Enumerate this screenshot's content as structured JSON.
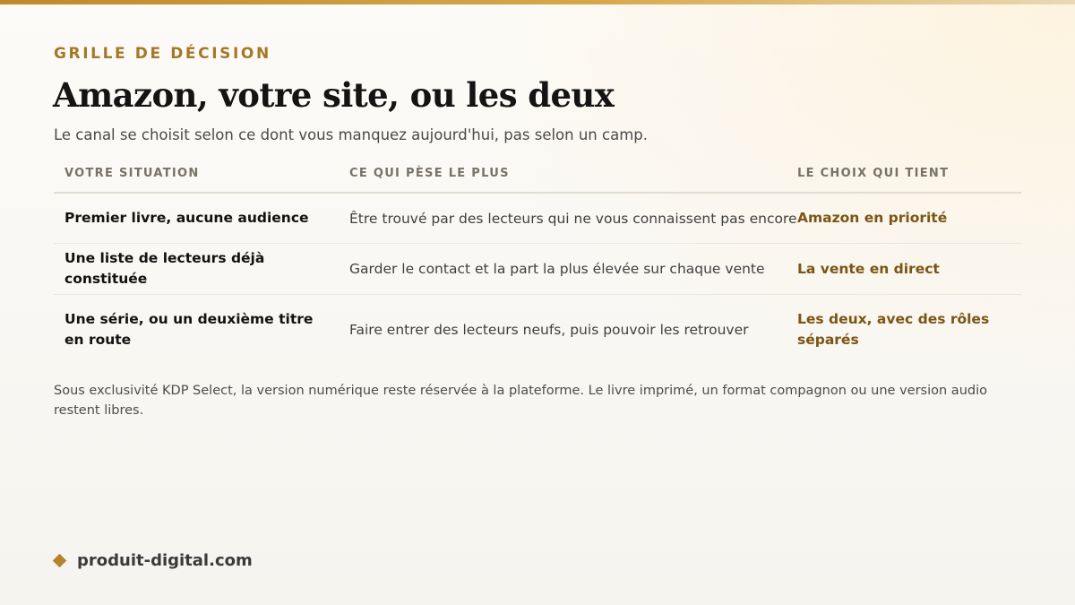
{
  "eyebrow": "GRILLE DE DÉCISION",
  "title": "Amazon, votre site, ou les deux",
  "subtitle": "Le canal se choisit selon ce dont vous manquez aujourd'hui, pas selon un camp.",
  "table": {
    "headers": [
      "VOTRE SITUATION",
      "CE QUI PÈSE LE PLUS",
      "LE CHOIX QUI TIENT"
    ],
    "rows": [
      {
        "situation": "Premier livre, aucune audience",
        "weight": "Être trouvé par des lecteurs qui ne vous connaissent pas encore",
        "choice": "Amazon en priorité"
      },
      {
        "situation": "Une liste de lecteurs déjà constituée",
        "weight": "Garder le contact et la part la plus élevée sur chaque vente",
        "choice": "La vente en direct"
      },
      {
        "situation": "Une série, ou un deuxième titre en route",
        "weight": "Faire entrer des lecteurs neufs, puis pouvoir les retrouver",
        "choice": "Les deux, avec des rôles séparés"
      }
    ]
  },
  "footnote": "Sous exclusivité KDP Select, la version numérique reste réservée à la plateforme. Le livre imprimé, un format compagnon ou une version audio restent libres.",
  "brand": {
    "icon": "diamond-icon",
    "name": "produit-digital.com"
  },
  "colors": {
    "accent": "#a57827",
    "choice": "#7a5514",
    "bar_start": "#c08a2a"
  }
}
